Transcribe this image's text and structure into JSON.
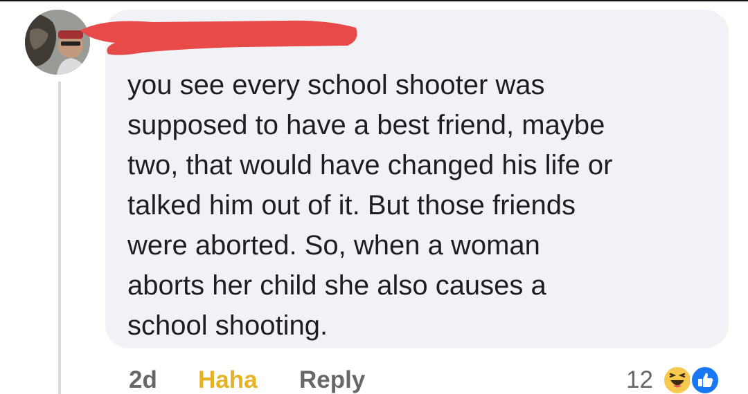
{
  "comment": {
    "text": "you see  every school shooter was\nsupposed to have a best friend, maybe\ntwo, that would have changed his life or\ntalked him out of it.  But those friends\nwere aborted.  So, when a woman\naborts her child she also causes a\nschool shooting."
  },
  "actions": {
    "timestamp": "2d",
    "reaction_label": "Haha",
    "reply_label": "Reply"
  },
  "reactions": {
    "count": "12",
    "icons": [
      "haha-icon",
      "like-icon"
    ]
  },
  "colors": {
    "bubble": "#f0f2f5",
    "text": "#1c1e21",
    "muted": "#65676b",
    "haha": "#e5b323",
    "like": "#1877f2",
    "redaction": "#e84a4a"
  }
}
